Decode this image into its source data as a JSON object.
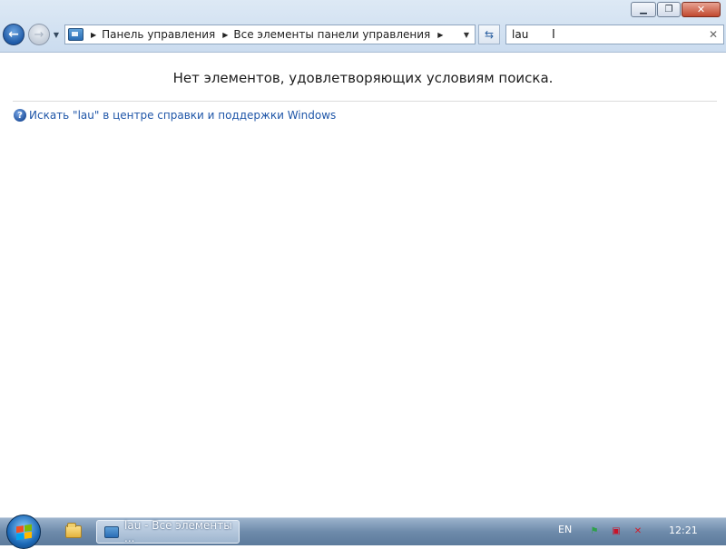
{
  "window": {
    "controls": {
      "minimize_icon": "minimize-icon",
      "restore_icon": "restore-icon",
      "close_icon": "close-icon"
    }
  },
  "nav": {
    "address_crumbs": [
      "Панель управления",
      "Все элементы панели управления"
    ],
    "search_value": "lau"
  },
  "content": {
    "empty_message": "Нет элементов, удовлетворяющих условиям поиска.",
    "help_link": "Искать \"lau\" в центре справки и поддержки Windows"
  },
  "taskbar": {
    "window_button_label": "lau - Все элементы ...",
    "language": "EN",
    "clock": "12:21"
  },
  "colors": {
    "link": "#1f56a8",
    "start_flag": [
      "#f25022",
      "#7fba00",
      "#00a4ef",
      "#ffb900"
    ]
  }
}
